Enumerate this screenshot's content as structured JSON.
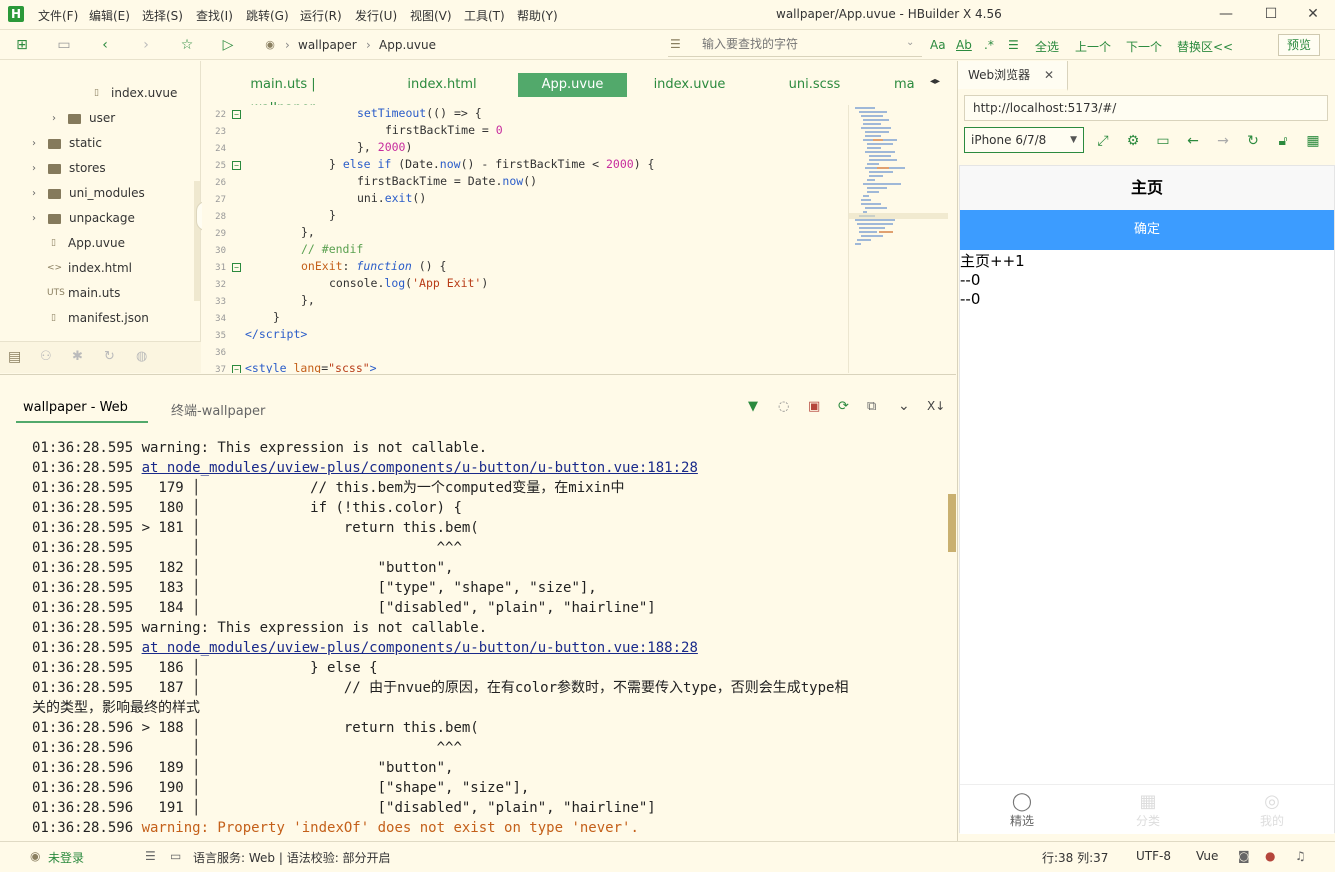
{
  "window": {
    "title": "wallpaper/App.uvue - HBuilder X 4.56",
    "logo": "H",
    "menu": [
      "文件(F)",
      "编辑(E)",
      "选择(S)",
      "查找(I)",
      "跳转(G)",
      "运行(R)",
      "发行(U)",
      "视图(V)",
      "工具(T)",
      "帮助(Y)"
    ]
  },
  "toolbar": {
    "breadcrumb": [
      "wallpaper",
      "App.uvue"
    ],
    "search_placeholder": "输入要查找的字符",
    "find_links": [
      "全选",
      "上一个",
      "下一个",
      "替换区<<"
    ],
    "preview": "预览",
    "find_toggles": [
      "Aa",
      "Ab"
    ]
  },
  "sidebar": {
    "items": [
      {
        "label": "index.uvue",
        "type": "file",
        "icon": "U",
        "indent": 2
      },
      {
        "label": "user",
        "type": "folder",
        "indent": 1
      },
      {
        "label": "static",
        "type": "folder",
        "indent": 0
      },
      {
        "label": "stores",
        "type": "folder",
        "indent": 0
      },
      {
        "label": "uni_modules",
        "type": "folder",
        "indent": 0
      },
      {
        "label": "unpackage",
        "type": "folder",
        "indent": 0
      },
      {
        "label": "App.uvue",
        "type": "file",
        "icon": "U",
        "indent": 0
      },
      {
        "label": "index.html",
        "type": "file",
        "icon": "<>",
        "indent": 0
      },
      {
        "label": "main.uts",
        "type": "file",
        "icon": "UTS",
        "indent": 0
      },
      {
        "label": "manifest.json",
        "type": "file",
        "icon": "{}",
        "indent": 0
      }
    ]
  },
  "tabs": [
    {
      "label": "main.uts | wallpaper",
      "active": false
    },
    {
      "label": "index.html",
      "active": false
    },
    {
      "label": "App.uvue",
      "active": true
    },
    {
      "label": "index.uvue",
      "active": false
    },
    {
      "label": "uni.scss",
      "active": false
    },
    {
      "label": "ma",
      "active": false
    }
  ],
  "editor": {
    "lines": [
      {
        "n": "22",
        "fold": true
      },
      {
        "n": "23"
      },
      {
        "n": "24"
      },
      {
        "n": "25",
        "fold": true
      },
      {
        "n": "26"
      },
      {
        "n": "27"
      },
      {
        "n": "28"
      },
      {
        "n": "29"
      },
      {
        "n": "30"
      },
      {
        "n": "31",
        "fold": true
      },
      {
        "n": "32"
      },
      {
        "n": "33"
      },
      {
        "n": "34"
      },
      {
        "n": "35"
      },
      {
        "n": "36"
      },
      {
        "n": "37",
        "fold": true
      }
    ]
  },
  "console": {
    "tabs": [
      "wallpaper - Web",
      "终端-wallpaper"
    ],
    "lines": [
      {
        "t": "01:36:28.595 ",
        "m": "warning: This expression is not callable.",
        "k": "text"
      },
      {
        "t": "01:36:28.595 ",
        "m": "at node_modules/uview-plus/components/u-button/u-button.vue:181:28",
        "k": "link"
      },
      {
        "t": "01:36:28.595 ",
        "m": "  179 │             // this.bem为一个computed变量，在mixin中",
        "k": "text"
      },
      {
        "t": "01:36:28.595 ",
        "m": "  180 │             if (!this.color) {",
        "k": "text"
      },
      {
        "t": "01:36:28.595 ",
        "m": "> 181 │                 return this.bem(",
        "k": "text"
      },
      {
        "t": "01:36:28.595 ",
        "m": "      │                            ^^^",
        "k": "text"
      },
      {
        "t": "01:36:28.595 ",
        "m": "  182 │                     \"button\",",
        "k": "text"
      },
      {
        "t": "01:36:28.595 ",
        "m": "  183 │                     [\"type\", \"shape\", \"size\"],",
        "k": "text"
      },
      {
        "t": "01:36:28.595 ",
        "m": "  184 │                     [\"disabled\", \"plain\", \"hairline\"]",
        "k": "text"
      },
      {
        "t": "01:36:28.595 ",
        "m": "warning: This expression is not callable.",
        "k": "text"
      },
      {
        "t": "01:36:28.595 ",
        "m": "at node_modules/uview-plus/components/u-button/u-button.vue:188:28",
        "k": "link"
      },
      {
        "t": "01:36:28.595 ",
        "m": "  186 │             } else {",
        "k": "text"
      },
      {
        "t": "01:36:28.595 ",
        "m": "  187 │                 // 由于nvue的原因，在有color参数时，不需要传入type，否则会生成type相",
        "k": "text"
      },
      {
        "t": "",
        "m": "关的类型，影响最终的样式",
        "k": "text"
      },
      {
        "t": "01:36:28.596 ",
        "m": "> 188 │                 return this.bem(",
        "k": "text"
      },
      {
        "t": "01:36:28.596 ",
        "m": "      │                            ^^^",
        "k": "text"
      },
      {
        "t": "01:36:28.596 ",
        "m": "  189 │                     \"button\",",
        "k": "text"
      },
      {
        "t": "01:36:28.596 ",
        "m": "  190 │                     [\"shape\", \"size\"],",
        "k": "text"
      },
      {
        "t": "01:36:28.596 ",
        "m": "  191 │                     [\"disabled\", \"plain\", \"hairline\"]",
        "k": "text"
      },
      {
        "t": "01:36:28.596 ",
        "m": "warning: Property 'indexOf' does not exist on type 'never'.",
        "k": "warn"
      }
    ]
  },
  "browser": {
    "tab": "Web浏览器",
    "url": "http://localhost:5173/#/",
    "device": "iPhone 6/7/8",
    "page": {
      "nav_title": "主页",
      "button": "确定",
      "texts": [
        "主页++1",
        "--0",
        "--0"
      ],
      "tabbar": [
        "精选",
        "分类",
        "我的"
      ]
    }
  },
  "status": {
    "login": "未登录",
    "lang": "语言服务: Web | 语法校验: 部分开启",
    "pos": "行:38  列:37",
    "encoding": "UTF-8",
    "syntax": "Vue"
  },
  "colors": {
    "accent": "#2b8a3e",
    "bg": "#fffae8",
    "active_tab": "#52a96b",
    "phone_btn": "#3c9cff"
  }
}
